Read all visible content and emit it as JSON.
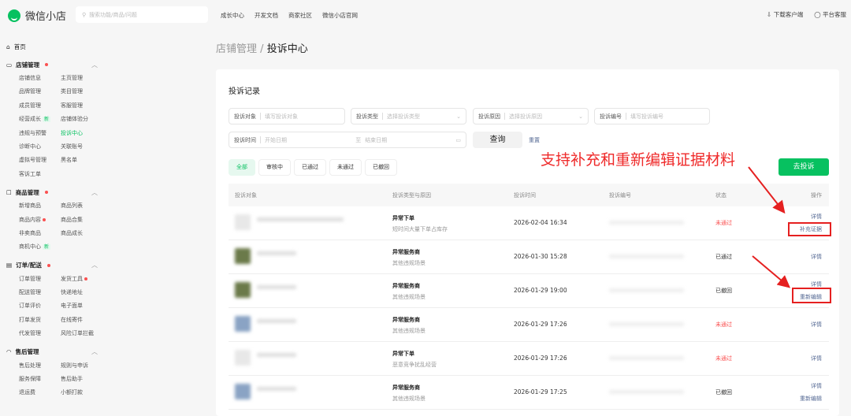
{
  "header": {
    "logo": "微信小店",
    "search_placeholder": "搜索功能/商品/问题",
    "nav": [
      "成长中心",
      "开发文档",
      "商家社区",
      "微信小店官网"
    ],
    "download": "下载客户端",
    "service": "平台客服"
  },
  "sidebar": {
    "home": "首页",
    "groups": [
      {
        "label": "店铺管理",
        "dot": true,
        "icon": "store-icon",
        "items": [
          {
            "label": "店铺信息"
          },
          {
            "label": "主页管理"
          },
          {
            "label": "品牌管理"
          },
          {
            "label": "类目管理"
          },
          {
            "label": "成员管理"
          },
          {
            "label": "客服管理"
          },
          {
            "label": "经营成长",
            "badge": "新"
          },
          {
            "label": "店铺体验分"
          },
          {
            "label": "违规与预警"
          },
          {
            "label": "投诉中心",
            "active": true
          },
          {
            "label": "诊断中心"
          },
          {
            "label": "关联账号"
          },
          {
            "label": "虚拟号管理"
          },
          {
            "label": "黑名单"
          },
          {
            "label": "客诉工单"
          }
        ]
      },
      {
        "label": "商品管理",
        "dot": true,
        "icon": "bag-icon",
        "items": [
          {
            "label": "新增商品"
          },
          {
            "label": "商品列表"
          },
          {
            "label": "商品内容",
            "dot": true
          },
          {
            "label": "商品合集"
          },
          {
            "label": "非卖商品"
          },
          {
            "label": "商品成长"
          },
          {
            "label": "商机中心",
            "badge": "新"
          }
        ]
      },
      {
        "label": "订单/配送",
        "dot": true,
        "icon": "clipboard-icon",
        "items": [
          {
            "label": "订单管理"
          },
          {
            "label": "发货工具",
            "dot": true
          },
          {
            "label": "配送管理"
          },
          {
            "label": "快递地址"
          },
          {
            "label": "订单评价"
          },
          {
            "label": "电子面单"
          },
          {
            "label": "打单发货"
          },
          {
            "label": "在线寄件"
          },
          {
            "label": "代发管理"
          },
          {
            "label": "风险订单拦截"
          }
        ]
      },
      {
        "label": "售后管理",
        "dot": false,
        "icon": "headset-icon",
        "items": [
          {
            "label": "售后处理"
          },
          {
            "label": "规则与申诉"
          },
          {
            "label": "服务保障"
          },
          {
            "label": "售后助手"
          },
          {
            "label": "退运费"
          },
          {
            "label": "小额打款"
          }
        ]
      }
    ]
  },
  "breadcrumb": {
    "parent": "店铺管理",
    "sep": "/",
    "current": "投诉中心"
  },
  "card_title": "投诉记录",
  "filters": {
    "target": {
      "label": "投诉对象",
      "placeholder": "填写投诉对象"
    },
    "type": {
      "label": "投诉类型",
      "placeholder": "选择投诉类型"
    },
    "reason": {
      "label": "投诉原因",
      "placeholder": "选择投诉原因"
    },
    "number": {
      "label": "投诉编号",
      "placeholder": "填写投诉编号"
    },
    "time": {
      "label": "投诉时间",
      "start": "开始日期",
      "to": "至",
      "end": "结束日期"
    },
    "query": "查询",
    "reset": "重置"
  },
  "tabs": [
    "全部",
    "审核中",
    "已通过",
    "未通过",
    "已撤回"
  ],
  "go_complain": "去投诉",
  "annotation": "支持补充和重新编辑证据材料",
  "table": {
    "headers": [
      "投诉对象",
      "投诉类型与原因",
      "投诉时间",
      "投诉编号",
      "状态",
      "操作"
    ],
    "rows": [
      {
        "type": "异常下单",
        "reason": "短时间大量下单占库存",
        "time": "2026-02-04 16:34",
        "status": "未通过",
        "actions": [
          "详情",
          "补充证据"
        ]
      },
      {
        "type": "异常服务商",
        "reason": "其他违规场景",
        "time": "2026-01-30 15:28",
        "status": "已通过",
        "actions": [
          "详情"
        ]
      },
      {
        "type": "异常服务商",
        "reason": "其他违规场景",
        "time": "2026-01-29 19:00",
        "status": "已撤回",
        "actions": [
          "详情",
          "重新编辑"
        ]
      },
      {
        "type": "异常服务商",
        "reason": "其他违规场景",
        "time": "2026-01-29 17:26",
        "status": "未通过",
        "actions": [
          "详情"
        ]
      },
      {
        "type": "异常下单",
        "reason": "恶意竞争扰乱经营",
        "time": "2026-01-29 17:26",
        "status": "未通过",
        "actions": [
          "详情"
        ]
      },
      {
        "type": "异常服务商",
        "reason": "其他违规场景",
        "time": "2026-01-29 17:25",
        "status": "已撤回",
        "actions": [
          "详情",
          "重新编辑"
        ]
      }
    ]
  },
  "colors": {
    "brand": "#07c160",
    "danger": "#fa5151",
    "link": "#576b95",
    "annotation": "#ef2a2a"
  }
}
